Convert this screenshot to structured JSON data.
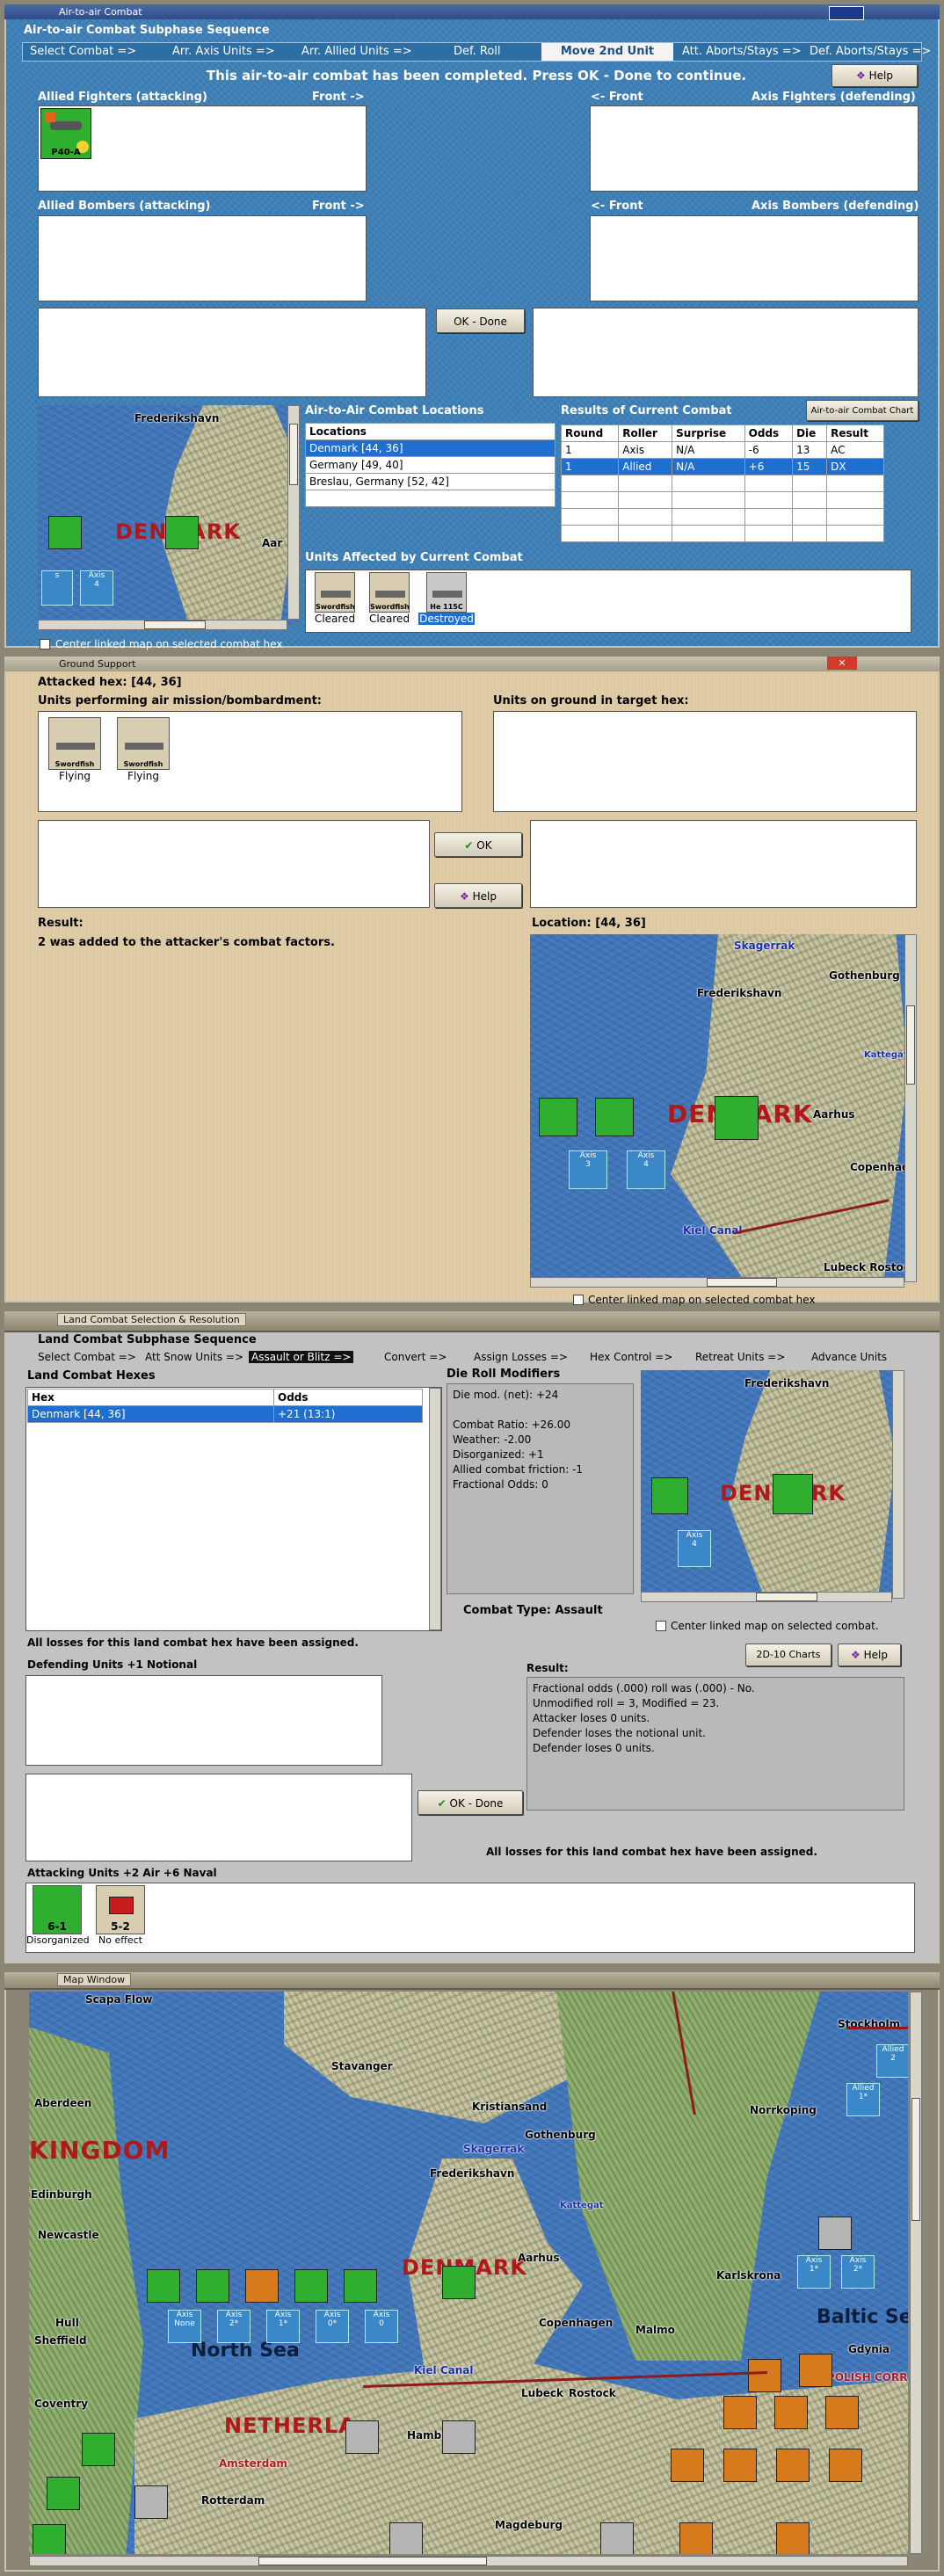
{
  "air_combat": {
    "window_title": "Air-to-air Combat",
    "group_title": "Air-to-air Combat Subphase Sequence",
    "steps": [
      "Select Combat =>",
      "Arr. Axis Units =>",
      "Arr. Allied Units =>",
      "Def. Roll",
      "Move 2nd Unit",
      "Att. Aborts/Stays =>",
      "Def. Aborts/Stays =>"
    ],
    "message": "This air-to-air combat has been completed.  Press OK - Done to continue.",
    "help_label": "Help",
    "allied_fighters_label": "Allied Fighters (attacking)",
    "front_right_label": "Front ->",
    "front_left_label": "<- Front",
    "axis_fighters_label": "Axis Fighters (defending)",
    "allied_bombers_label": "Allied Bombers (attacking)",
    "axis_bombers_label": "Axis Bombers (defending)",
    "ok_done_label": "OK - Done",
    "fighter_counter_name": "P40-A",
    "locations_heading": "Air-to-Air Combat Locations",
    "locations_col": "Locations",
    "locations": [
      "Denmark [44, 36]",
      "Germany [49, 40]",
      "Breslau, Germany [52, 42]"
    ],
    "results_heading": "Results of Current Combat",
    "chart_button": "Air-to-air Combat Chart",
    "results_cols": [
      "Round",
      "Roller",
      "Surprise",
      "Odds",
      "Die",
      "Result"
    ],
    "results_rows": [
      [
        "1",
        "Axis",
        "N/A",
        "-6",
        "13",
        "AC"
      ],
      [
        "1",
        "Allied",
        "N/A",
        "+6",
        "15",
        "DX"
      ]
    ],
    "units_affected_heading": "Units Affected by Current Combat",
    "affected_units": [
      {
        "name": "Swordfish",
        "status": "Cleared"
      },
      {
        "name": "Swordfish",
        "status": "Cleared"
      },
      {
        "name": "He 115C",
        "status": "Destroyed"
      }
    ],
    "center_map_label": "Center linked map on selected combat hex",
    "map_labels": {
      "frederikshavn": "Frederikshavn",
      "denmark": "DENMARK",
      "aarhus": "Aar",
      "axis": "Axis"
    }
  },
  "ground_support": {
    "window_title": "Ground Support",
    "attacked_hex": "Attacked hex:  [44, 36]",
    "performing_label": "Units performing air mission/bombardment:",
    "on_ground_label": "Units on ground in target hex:",
    "performing_units": [
      {
        "name": "Swordfish",
        "status": "Flying"
      },
      {
        "name": "Swordfish",
        "status": "Flying"
      }
    ],
    "ok_label": "OK",
    "help_label": "Help",
    "result_label": "Result:",
    "result_text": "2 was added to the attacker's combat factors.",
    "location_label": "Location:  [44, 36]",
    "center_map_label": "Center linked map on selected combat hex",
    "map_labels": {
      "skagerrak": "Skagerrak",
      "frederikshavn": "Frederikshavn",
      "gothenburg": "Gothenburg",
      "kattegat": "Kattegat",
      "denmark": "DENMARK",
      "aarhus": "Aarhus",
      "copenhagen": "Copenhagen",
      "kiel_canal": "Kiel Canal",
      "lubeck": "Lubeck Rostock",
      "axis": "Axis"
    }
  },
  "land_combat": {
    "window_title": "Land Combat Selection & Resolution",
    "group_title": "Land Combat Subphase Sequence",
    "steps": [
      "Select Combat =>",
      "Att Snow Units =>",
      "Assault or Blitz =>",
      "Convert =>",
      "Assign Losses =>",
      "Hex Control =>",
      "Retreat Units =>",
      "Advance Units"
    ],
    "hexes_label": "Land Combat Hexes",
    "hex_col": "Hex",
    "odds_col": "Odds",
    "hex_row": {
      "hex": "Denmark [44, 36]",
      "odds": "+21 (13:1)"
    },
    "die_roll_heading": "Die Roll Modifiers",
    "die_roll_lines": [
      "Die mod. (net): +24",
      "",
      "Combat Ratio: +26.00",
      "Weather: -2.00",
      "Disorganized: +1",
      "Allied combat friction: -1",
      "Fractional Odds: 0"
    ],
    "combat_type_label": "Combat Type:  Assault",
    "center_map_label": "Center linked map on selected combat.",
    "losses_msg": "All losses for this land combat hex have been assigned.",
    "defending_label": "Defending Units +1 Notional",
    "charts_button": "2D-10 Charts",
    "help_label": "Help",
    "result_label": "Result:",
    "result_lines": [
      "Fractional odds (.000) roll was (.000)  - No.",
      "Unmodified roll = 3, Modified = 23.",
      "Attacker loses 0 units.",
      "Defender loses the notional unit.",
      "Defender loses 0 units."
    ],
    "ok_done_label": "OK - Done",
    "losses_msg_2": "All losses for this land combat hex have been assigned.",
    "attacking_label": "Attacking Units +2 Air +6 Naval",
    "attacking_units": [
      {
        "value": "6-1",
        "status": "Disorganized"
      },
      {
        "value": "5-2",
        "status": "No effect"
      }
    ],
    "map_labels": {
      "frederikshavn": "Frederikshavn",
      "denmark": "DENMARK",
      "axis": "Axis"
    }
  },
  "main_map": {
    "window_title": "Map Window",
    "labels": {
      "scapa_flow": "Scapa Flow",
      "aberdeen": "Aberdeen",
      "kingdom": "KINGDOM",
      "stavanger": "Stavanger",
      "kristiansand": "Kristiansand",
      "skagerrak": "Skagerrak",
      "gothenburg": "Gothenburg",
      "frederikshavn": "Frederikshavn",
      "kattegat": "Kattegat",
      "norrkoping": "Norrkoping",
      "stockholm": "Stockholm",
      "edinburgh": "Edinburgh",
      "newcastle": "Newcastle",
      "denmark": "DENMARK",
      "aarhus": "Aarhus",
      "karlskrona": "Karlskrona",
      "baltic_sea": "Baltic Sea",
      "north_sea": "North Sea",
      "hull": "Hull",
      "sheffield": "Sheffield",
      "copenhagen": "Copenhagen",
      "malmo": "Malmo",
      "gdynia": "Gdynia",
      "kiel_canal": "Kiel Canal",
      "lubeck": "Lubeck",
      "rostock": "Rostock",
      "polish_corridor": "POLISH CORR",
      "coventry": "Coventry",
      "netherlands": "NETHERLA",
      "amsterdam": "Amsterdam",
      "rotterdam": "Rotterdam",
      "hamburg": "Hamburg",
      "magdeburg": "Magdeburg",
      "axis": "Axis",
      "allied": "Allied",
      "none": "None"
    }
  },
  "colors": {
    "sea": "#3f74b8",
    "panel_blue": "#3d7fb6",
    "panel_tan": "#ddc9a4",
    "panel_grey": "#c2c2c2",
    "allied_green": "#2fae2f",
    "axis_orange": "#d67a1c",
    "selection": "#1e6fd0",
    "country_red": "#b01919"
  }
}
